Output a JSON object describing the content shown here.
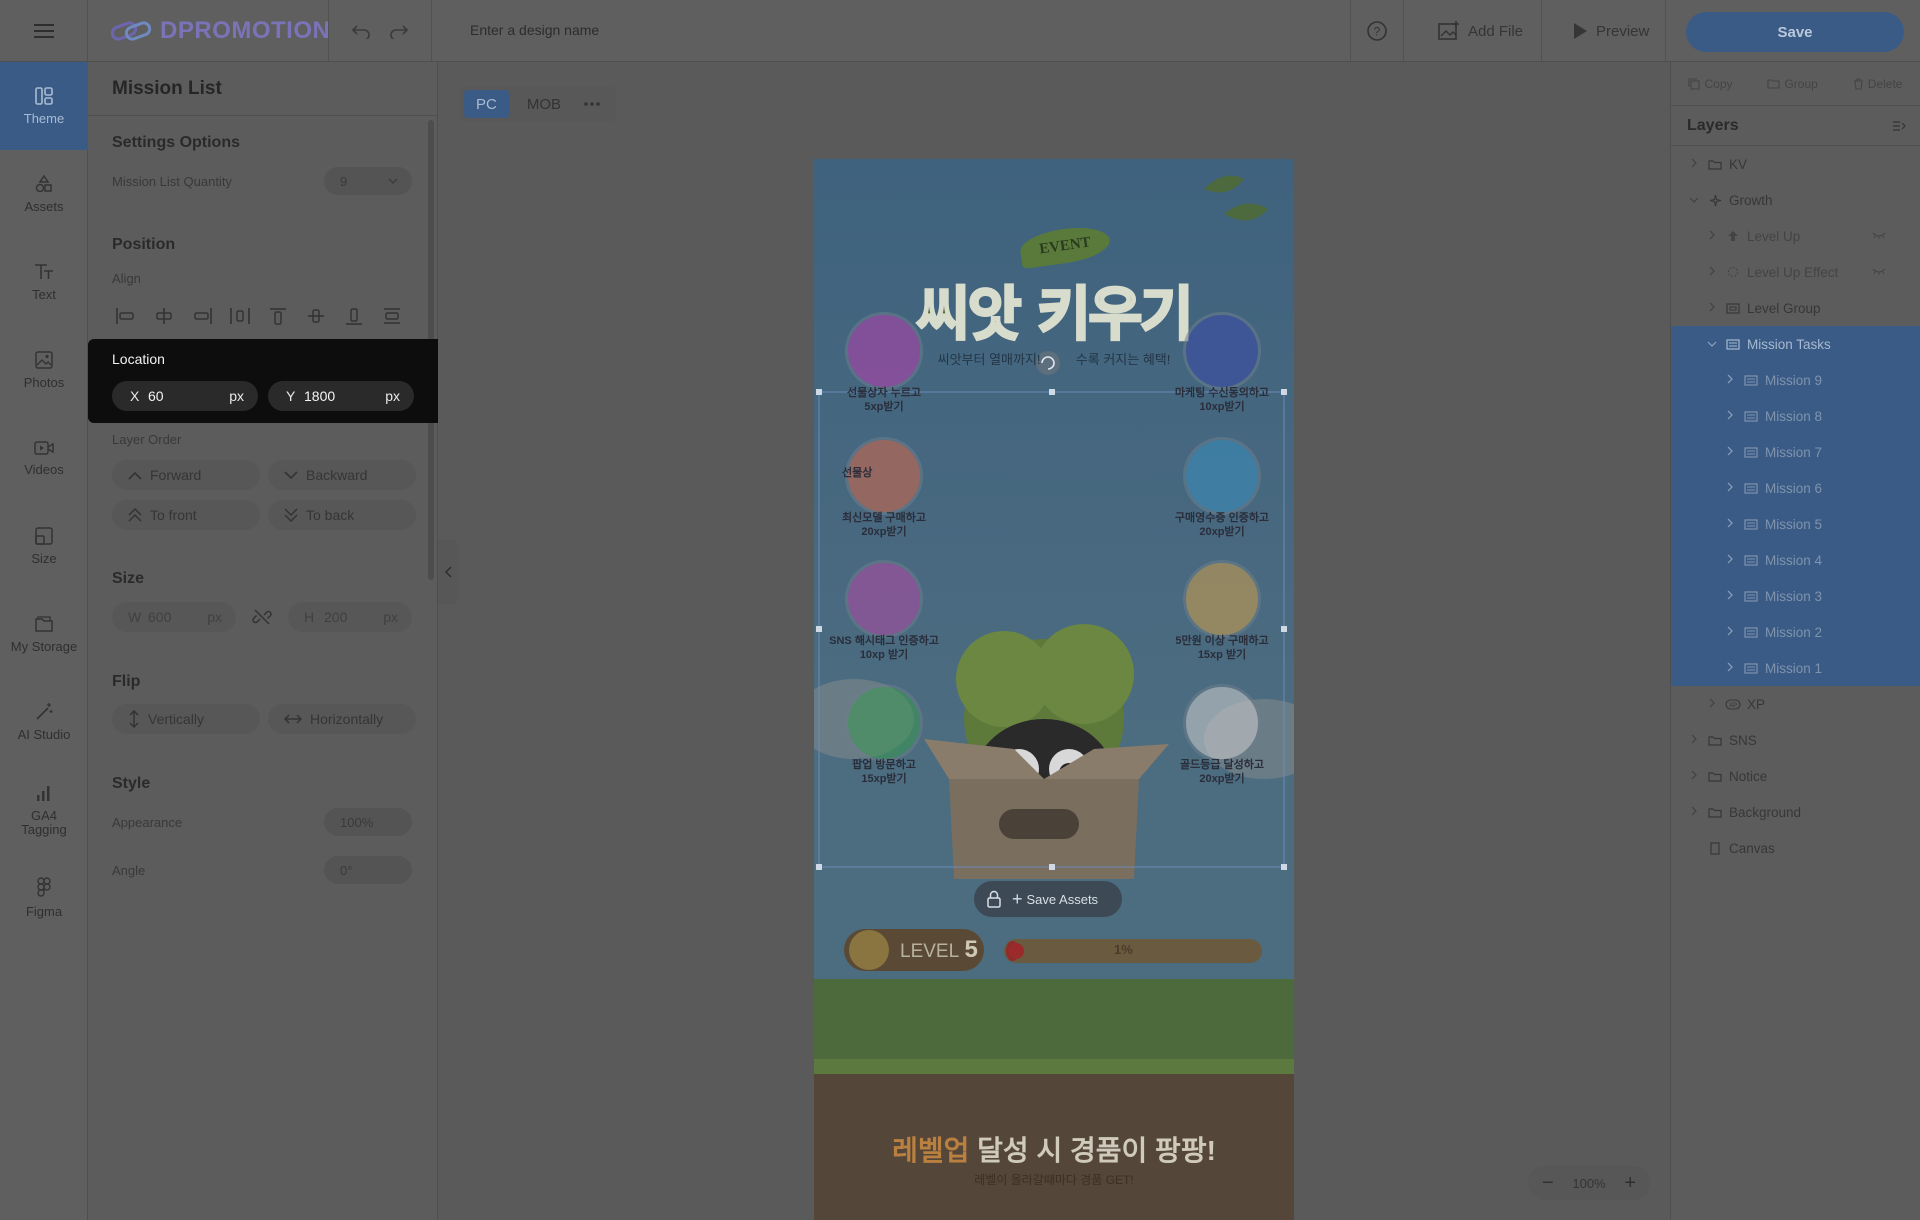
{
  "app": {
    "logo_text": "DPROMOTION",
    "design_name_placeholder": "Enter a design name"
  },
  "topbar": {
    "add_file": "Add File",
    "preview": "Preview",
    "save": "Save"
  },
  "rail": {
    "items": [
      {
        "label": "Theme"
      },
      {
        "label": "Assets"
      },
      {
        "label": "Text"
      },
      {
        "label": "Photos"
      },
      {
        "label": "Videos"
      },
      {
        "label": "Size"
      },
      {
        "label": "My Storage"
      },
      {
        "label": "AI Studio"
      },
      {
        "label": "GA4\nTagging"
      },
      {
        "label": "Figma"
      }
    ]
  },
  "panel": {
    "title": "Mission List",
    "settings_title": "Settings Options",
    "mission_quantity_label": "Mission List Quantity",
    "mission_quantity_value": "9",
    "position_title": "Position",
    "align_label": "Align",
    "location_label": "Location",
    "x_key": "X",
    "x_value": "60",
    "y_key": "Y",
    "y_value": "1800",
    "unit": "px",
    "layer_order_label": "Layer Order",
    "forward": "Forward",
    "backward": "Backward",
    "to_front": "To front",
    "to_back": "To back",
    "size_title": "Size",
    "w_key": "W",
    "w_value": "600",
    "h_key": "H",
    "h_value": "200",
    "flip_title": "Flip",
    "vertically": "Vertically",
    "horizontally": "Horizontally",
    "style_title": "Style",
    "appearance_label": "Appearance",
    "appearance_value": "100%",
    "angle_label": "Angle",
    "angle_value": "0°"
  },
  "canvas": {
    "tabs": [
      "PC",
      "MOB"
    ],
    "zoom": "100%",
    "save_assets": "Save Assets",
    "event_badge": "EVENT",
    "headline": "씨앗 키우기",
    "subheadline_left": "씨앗부터 열매까지!",
    "subheadline_right": "수록 커지는 혜택!",
    "level_prefix": "LEVEL",
    "level_number": "5",
    "progress_text": "1%",
    "progress_fraction": 0.05,
    "bottom_title_highlight": "레벨업",
    "bottom_title_rest": "달성 시 경품이 팡팡!",
    "bottom_subtitle": "레벨이 올라갈때마다 경품 GET!",
    "missions": [
      {
        "line1": "선물상자 누르고",
        "line2": "5xp받기",
        "color": "#b73fb0"
      },
      {
        "line1": "마케팅 수신동의하고",
        "line2": "10xp받기",
        "color": "#3a4aa8"
      },
      {
        "line1": "최신모델 구매하고",
        "line2": "20xp받기",
        "color": "#d6674a"
      },
      {
        "line1": "구매영수증 인증하고",
        "line2": "20xp받기",
        "color": "#3a8fbf"
      },
      {
        "line1": "SNS 해시태그 인증하고",
        "line2": "10xp 받기",
        "color": "#b24aa6"
      },
      {
        "line1": "5만원 이상 구매하고",
        "line2": "15xp 받기",
        "color": "#d0a14a"
      },
      {
        "line1": "팝업 방문하고",
        "line2": "15xp받기",
        "color": "#3b9a52"
      },
      {
        "line1": "골드등급 달성하고",
        "line2": "20xp받기",
        "color": "#cfcfcf"
      }
    ],
    "first_mission_partial": "선물상"
  },
  "right": {
    "copy": "Copy",
    "group": "Group",
    "delete": "Delete",
    "layers_title": "Layers",
    "layers": [
      {
        "label": "KV",
        "level": 0,
        "icon": "folder-icon",
        "chev": "right",
        "state": "none"
      },
      {
        "label": "Growth",
        "level": 0,
        "icon": "sparkle-icon",
        "chev": "down",
        "state": "none"
      },
      {
        "label": "Level Up",
        "level": 1,
        "icon": "arrow-up-icon",
        "chev": "right",
        "state": "dim",
        "eye": true
      },
      {
        "label": "Level Up Effect",
        "level": 1,
        "icon": "dashed-circle-icon",
        "chev": "right",
        "state": "dim",
        "eye": true
      },
      {
        "label": "Level Group",
        "level": 1,
        "icon": "frame-icon",
        "chev": "right",
        "state": "none"
      },
      {
        "label": "Mission Tasks",
        "level": 1,
        "icon": "list-icon",
        "chev": "down",
        "state": "sel"
      },
      {
        "label": "Mission 9",
        "level": 2,
        "icon": "list-icon",
        "chev": "right",
        "state": "child"
      },
      {
        "label": "Mission 8",
        "level": 2,
        "icon": "list-icon",
        "chev": "right",
        "state": "child"
      },
      {
        "label": "Mission 7",
        "level": 2,
        "icon": "list-icon",
        "chev": "right",
        "state": "child"
      },
      {
        "label": "Mission 6",
        "level": 2,
        "icon": "list-icon",
        "chev": "right",
        "state": "child"
      },
      {
        "label": "Mission 5",
        "level": 2,
        "icon": "list-icon",
        "chev": "right",
        "state": "child"
      },
      {
        "label": "Mission 4",
        "level": 2,
        "icon": "list-icon",
        "chev": "right",
        "state": "child"
      },
      {
        "label": "Mission 3",
        "level": 2,
        "icon": "list-icon",
        "chev": "right",
        "state": "child"
      },
      {
        "label": "Mission 2",
        "level": 2,
        "icon": "list-icon",
        "chev": "right",
        "state": "child"
      },
      {
        "label": "Mission 1",
        "level": 2,
        "icon": "list-icon",
        "chev": "right",
        "state": "child"
      },
      {
        "label": "XP",
        "level": 1,
        "icon": "xp-icon",
        "chev": "right",
        "state": "none"
      },
      {
        "label": "SNS",
        "level": 0,
        "icon": "folder-icon",
        "chev": "right",
        "state": "none"
      },
      {
        "label": "Notice",
        "level": 0,
        "icon": "folder-icon",
        "chev": "right",
        "state": "none"
      },
      {
        "label": "Background",
        "level": 0,
        "icon": "folder-icon",
        "chev": "right",
        "state": "none"
      },
      {
        "label": "Canvas",
        "level": 0,
        "icon": "page-icon",
        "chev": "none",
        "state": "none"
      }
    ]
  }
}
